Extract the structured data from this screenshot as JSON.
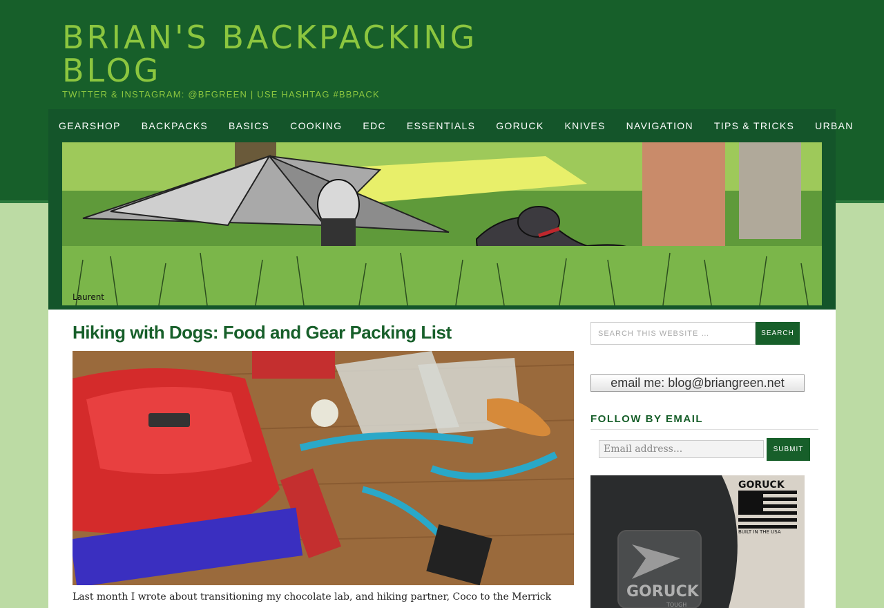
{
  "site": {
    "title": "BRIAN'S BACKPACKING BLOG",
    "tagline": "TWITTER & INSTAGRAM: @BFGREEN | USE HASHTAG #BBPACK"
  },
  "nav": {
    "items": [
      {
        "label": "GEARSHOP"
      },
      {
        "label": "BACKPACKS"
      },
      {
        "label": "BASICS"
      },
      {
        "label": "COOKING"
      },
      {
        "label": "EDC"
      },
      {
        "label": "ESSENTIALS"
      },
      {
        "label": "GORUCK"
      },
      {
        "label": "KNIVES"
      },
      {
        "label": "NAVIGATION"
      },
      {
        "label": "TIPS & TRICKS"
      },
      {
        "label": "URBAN"
      }
    ]
  },
  "post": {
    "title": "Hiking with Dogs: Food and Gear Packing List",
    "excerpt": "Last month I wrote about transitioning my chocolate lab, and hiking partner, Coco to the Merrick"
  },
  "sidebar": {
    "search_placeholder": "SEARCH THIS WEBSITE …",
    "search_button": "SEARCH",
    "email_banner": "email me: blog@briangreen.net",
    "follow_heading": "FOLLOW BY EMAIL",
    "email_placeholder": "Email address...",
    "submit_button": "SUBMIT",
    "ad_text": {
      "brand": "GORUCK",
      "built": "BUILT IN THE USA",
      "patch": "GORUCK",
      "patch_sub": "TOUGH"
    }
  },
  "banner_signature": "Laurent",
  "colors": {
    "header_green": "#175f2a",
    "nav_green": "#14552a",
    "title_lime": "#8cc63f",
    "page_bg": "#bcdba4"
  }
}
